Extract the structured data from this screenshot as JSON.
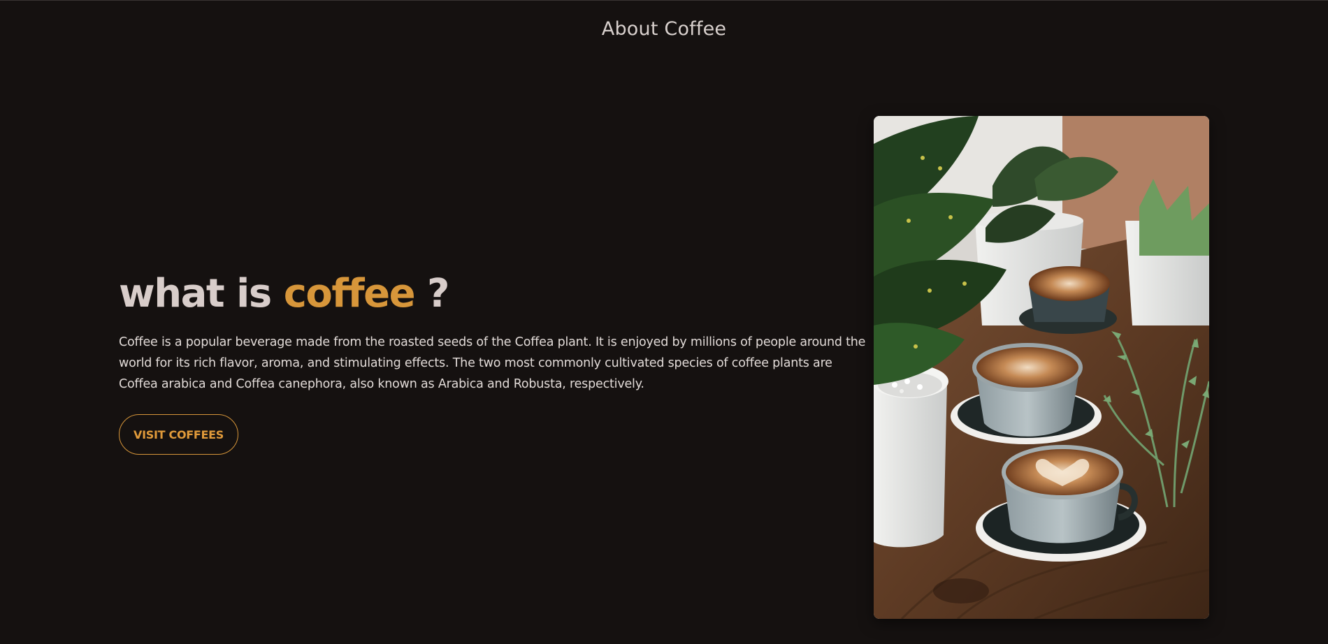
{
  "section": {
    "title": "About Coffee"
  },
  "hero": {
    "heading_prefix": "what is",
    "heading_accent": "coffee",
    "heading_suffix": "?",
    "description": "Coffee is a popular beverage made from the roasted seeds of the Coffea plant. It is enjoyed by millions of people around the world for its rich flavor, aroma, and stimulating effects. The two most commonly cultivated species of coffee plants are Coffea arabica and Coffea canephora, also known as Arabica and Robusta, respectively.",
    "button_label": "VISIT COFFEES"
  },
  "colors": {
    "background": "#151110",
    "accent": "#d7963a",
    "text": "#d8cdca"
  }
}
